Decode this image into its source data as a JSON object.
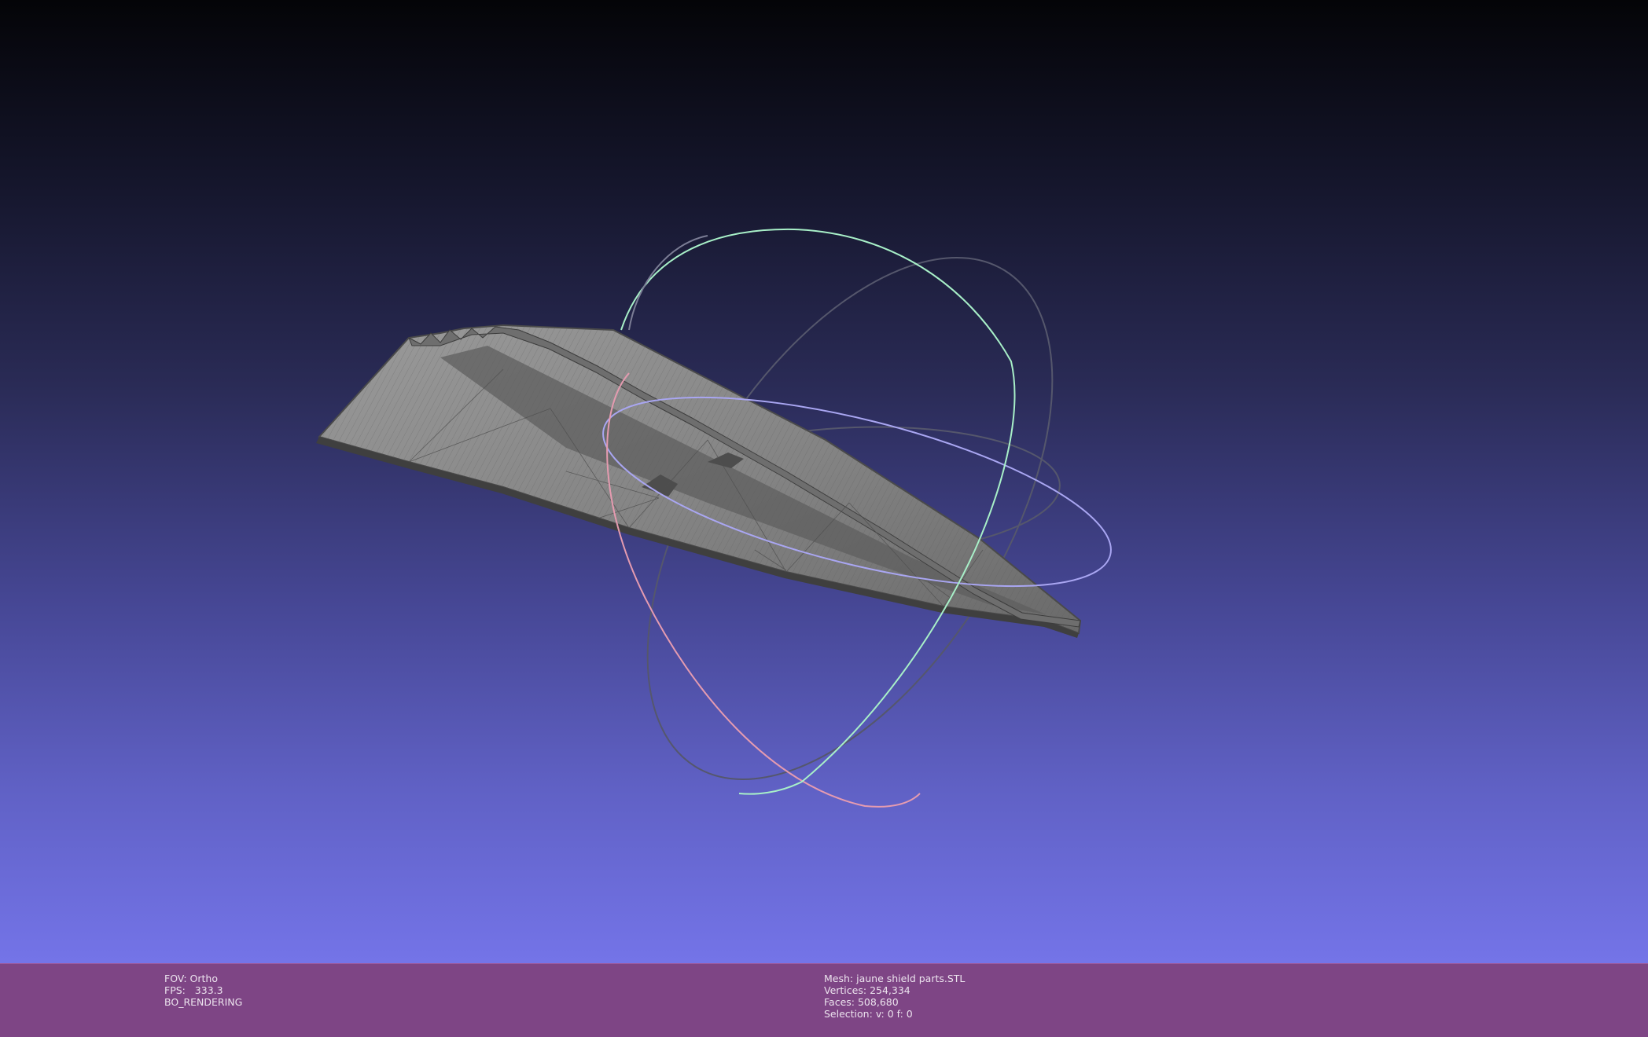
{
  "viewer": {
    "background_top": "#040407",
    "background_bottom": "#7474e8",
    "status_bar_color": "#7e4585",
    "mesh_color": "#8a8a8a",
    "trackball_colors": {
      "x_ring": "#e59bb0",
      "y_ring": "#a8f0c8",
      "z_ring": "#a9a6f2",
      "shadow_rings": "#55576c"
    }
  },
  "status_left": {
    "fov_label": "FOV:",
    "fov_value": "Ortho",
    "fps_label": "FPS:",
    "fps_value": "333.3",
    "render_mode": "BO_RENDERING"
  },
  "status_right": {
    "mesh_label": "Mesh:",
    "mesh_name": "jaune shield parts.STL",
    "vertices_label": "Vertices:",
    "vertices_value": "254,334",
    "faces_label": "Faces:",
    "faces_value": "508,680",
    "selection_label": "Selection:",
    "selection_value": "v: 0 f: 0"
  }
}
